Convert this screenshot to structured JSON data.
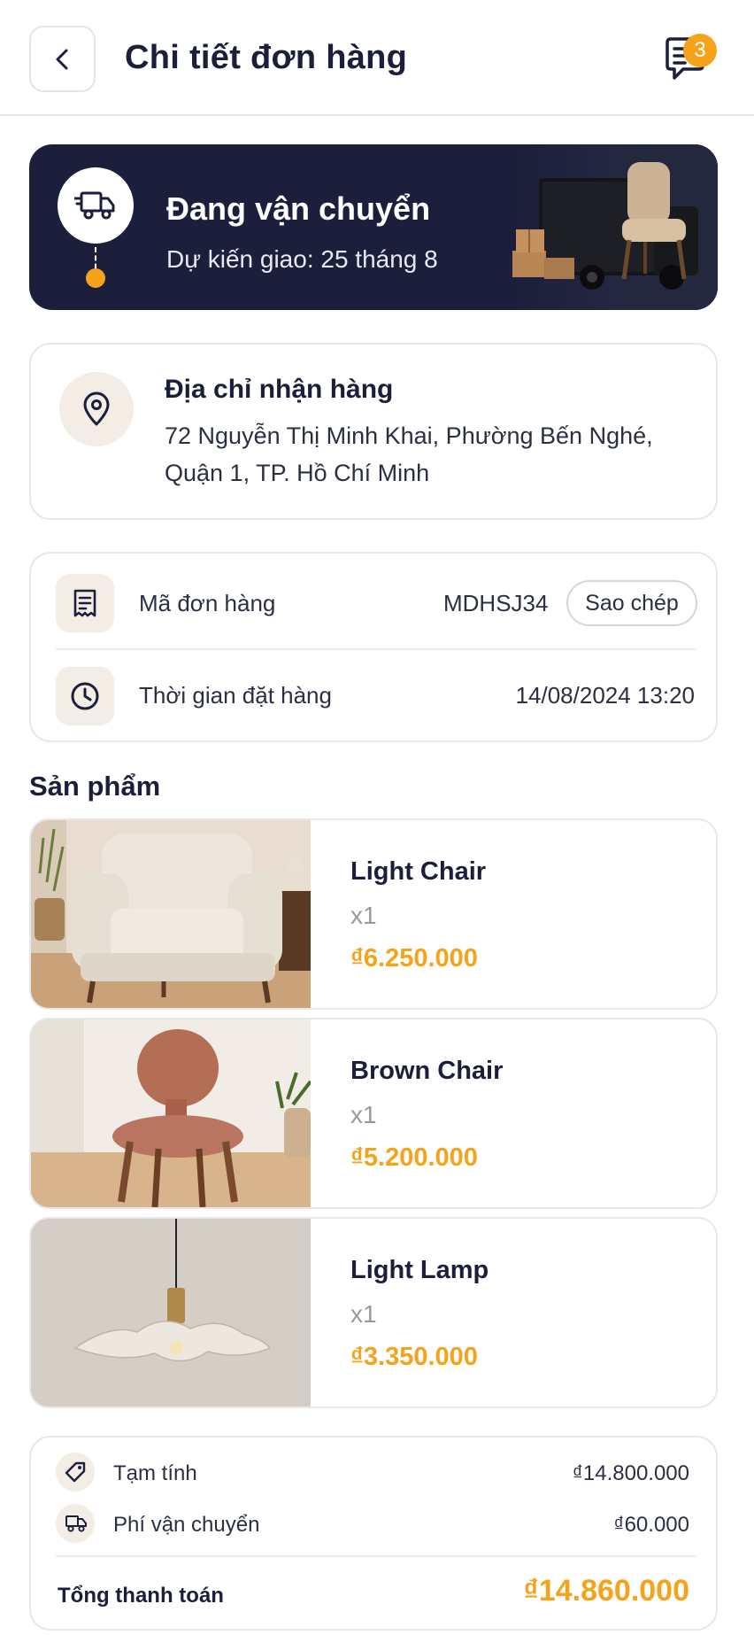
{
  "header": {
    "title": "Chi tiết đơn hàng",
    "notification_count": "3"
  },
  "status": {
    "title": "Đang vận chuyển",
    "subtitle": "Dự kiến giao: 25 tháng 8"
  },
  "address": {
    "title": "Địa chỉ nhận hàng",
    "line1": "72 Nguyễn Thị Minh Khai, Phường Bến Nghé,",
    "line2": "Quận 1, TP. Hồ Chí Minh"
  },
  "order_info": {
    "code_label": "Mã đơn hàng",
    "code_value": "MDHSJ34",
    "copy_label": "Sao chép",
    "time_label": "Thời gian đặt hàng",
    "time_value": "14/08/2024 13:20"
  },
  "products_section_title": "Sản phẩm",
  "products": [
    {
      "name": "Light Chair",
      "qty": "x1",
      "price": "₫6.250.000"
    },
    {
      "name": "Brown Chair",
      "qty": "x1",
      "price": "₫5.200.000"
    },
    {
      "name": "Light Lamp",
      "qty": "x1",
      "price": "₫3.350.000"
    }
  ],
  "summary": {
    "subtotal_label": "Tạm tính",
    "subtotal_value": "₫14.800.000",
    "shipping_label": "Phí vận chuyển",
    "shipping_value": "₫60.000",
    "total_label": "Tổng thanh toán",
    "total_value": "₫14.860.000"
  },
  "colors": {
    "accent": "#f5a31a",
    "dark": "#1b1f3b",
    "icon_bg": "#f3ede6"
  },
  "icons": [
    "back-arrow-icon",
    "chat-icon",
    "truck-icon",
    "location-pin-icon",
    "receipt-icon",
    "clock-icon",
    "tag-icon",
    "shipping-truck-icon"
  ]
}
